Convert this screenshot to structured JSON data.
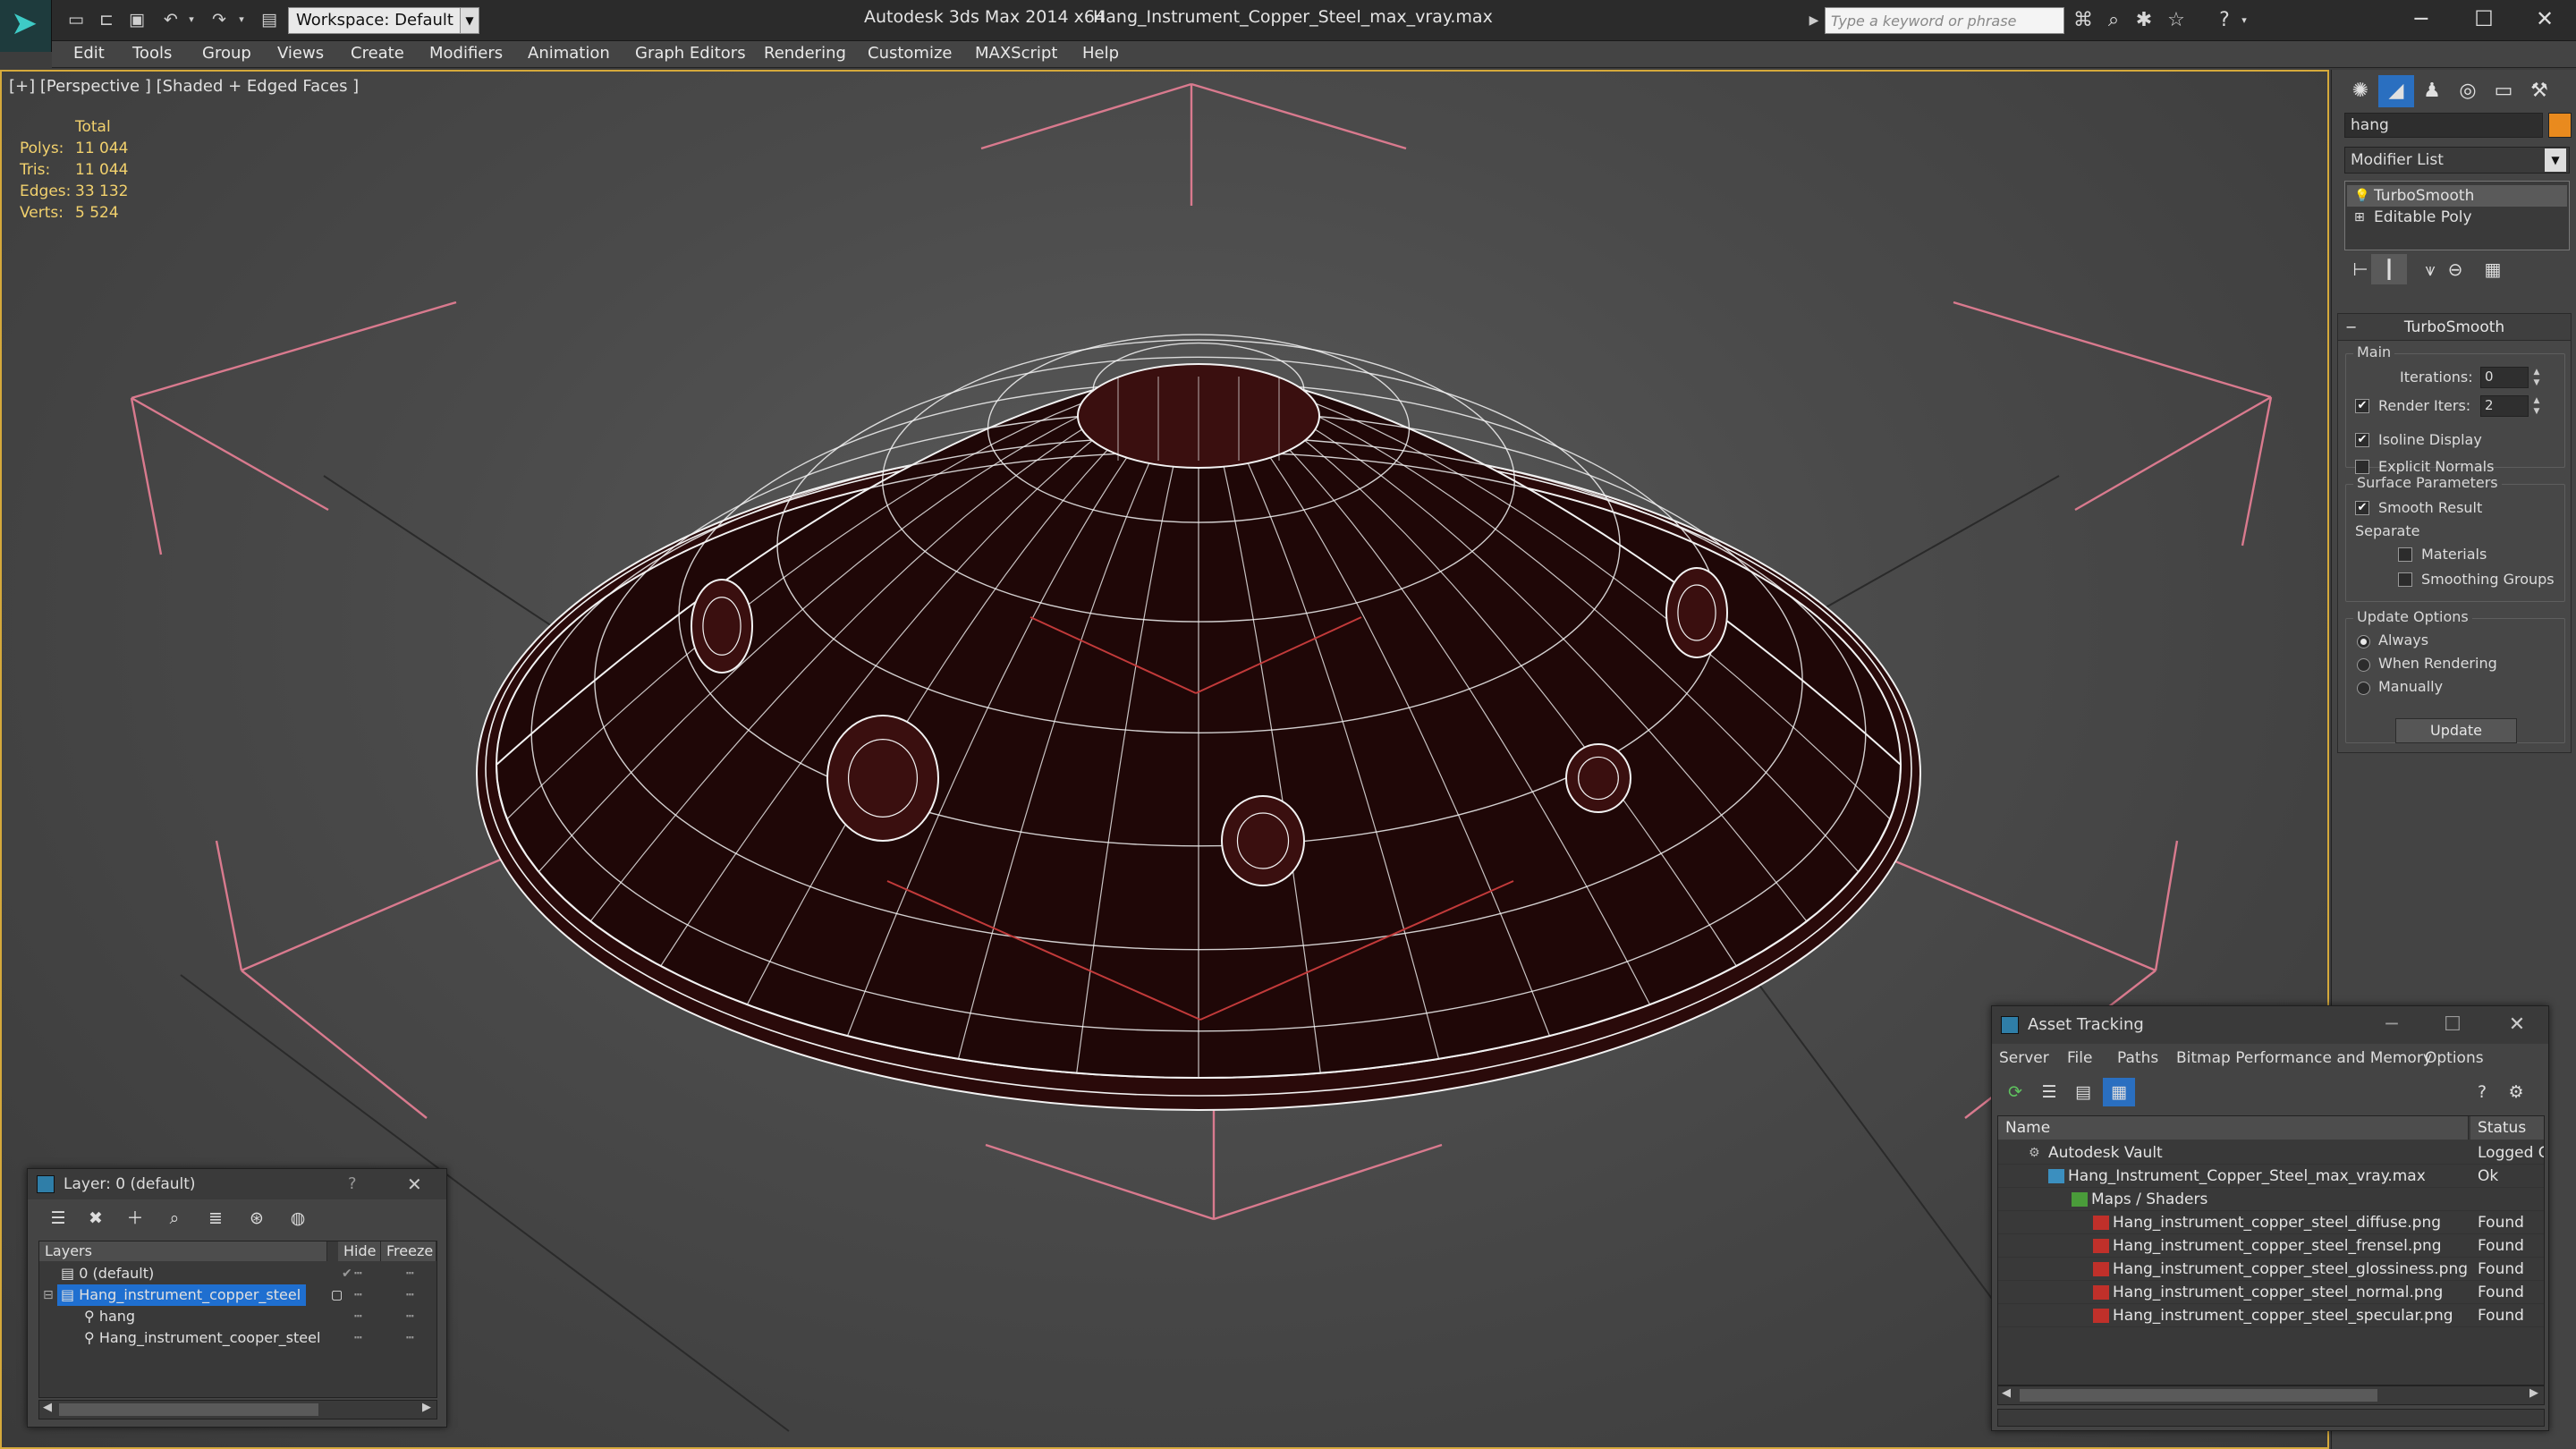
{
  "app": {
    "title": "Autodesk 3ds Max 2014 x64",
    "file_title": "Hang_Instrument_Copper_Steel_max_vray.max",
    "workspace": "Workspace: Default",
    "search_placeholder": "Type a keyword or phrase"
  },
  "menu": [
    "Edit",
    "Tools",
    "Group",
    "Views",
    "Create",
    "Modifiers",
    "Animation",
    "Graph Editors",
    "Rendering",
    "Customize",
    "MAXScript",
    "Help"
  ],
  "viewport": {
    "label": "[+] [Perspective ] [Shaded + Edged Faces ]",
    "stats": {
      "header": "Total",
      "rows": [
        {
          "label": "Polys:",
          "value": "11 044"
        },
        {
          "label": "Tris:",
          "value": "11 044"
        },
        {
          "label": "Edges:",
          "value": "33 132"
        },
        {
          "label": "Verts:",
          "value": "5 524"
        }
      ]
    }
  },
  "command_panel": {
    "object_name": "hang",
    "modifier_list": "Modifier List",
    "stack": [
      "TurboSmooth",
      "Editable Poly"
    ],
    "turbosmooth": {
      "title": "TurboSmooth",
      "main_group": "Main",
      "iterations_label": "Iterations:",
      "iterations_value": "0",
      "render_iters_label": "Render Iters:",
      "render_iters_value": "2",
      "isoline_display": "Isoline Display",
      "explicit_normals": "Explicit Normals",
      "surface_group": "Surface Parameters",
      "smooth_result": "Smooth Result",
      "separate_label": "Separate",
      "materials": "Materials",
      "smoothing_groups": "Smoothing Groups",
      "update_group": "Update Options",
      "always": "Always",
      "when_rendering": "When Rendering",
      "manually": "Manually",
      "update_button": "Update"
    }
  },
  "layer_explorer": {
    "title": "Layer: 0 (default)",
    "help": "?",
    "columns": [
      "Layers",
      "Hide",
      "Freeze"
    ],
    "rows": [
      {
        "name": "0 (default)",
        "selected": false,
        "indent": 0
      },
      {
        "name": "Hang_instrument_copper_steel",
        "selected": true,
        "indent": 0
      },
      {
        "name": "hang",
        "selected": false,
        "indent": 1
      },
      {
        "name": "Hang_instrument_cooper_steel",
        "selected": false,
        "indent": 1
      }
    ]
  },
  "asset_tracking": {
    "title": "Asset Tracking",
    "menu": [
      "Server",
      "File",
      "Paths",
      "Bitmap Performance and Memory",
      "Options"
    ],
    "columns": [
      "Name",
      "Status"
    ],
    "rows": [
      {
        "name": "Autodesk Vault",
        "status": "Logged O",
        "indent": 1
      },
      {
        "name": "Hang_Instrument_Copper_Steel_max_vray.max",
        "status": "Ok",
        "indent": 2
      },
      {
        "name": "Maps / Shaders",
        "status": "",
        "indent": 3
      },
      {
        "name": "Hang_instrument_copper_steel_diffuse.png",
        "status": "Found",
        "indent": 4
      },
      {
        "name": "Hang_instrument_copper_steel_frensel.png",
        "status": "Found",
        "indent": 4
      },
      {
        "name": "Hang_instrument_copper_steel_glossiness.png",
        "status": "Found",
        "indent": 4
      },
      {
        "name": "Hang_instrument_copper_steel_normal.png",
        "status": "Found",
        "indent": 4
      },
      {
        "name": "Hang_instrument_copper_steel_specular.png",
        "status": "Found",
        "indent": 4
      }
    ]
  },
  "colors": {
    "accent": "#d5a93b",
    "selection": "#1f6fd0",
    "object_color": "#e98a1e",
    "wire": "#f2f2f2",
    "mesh_fill": "#1f0707"
  }
}
